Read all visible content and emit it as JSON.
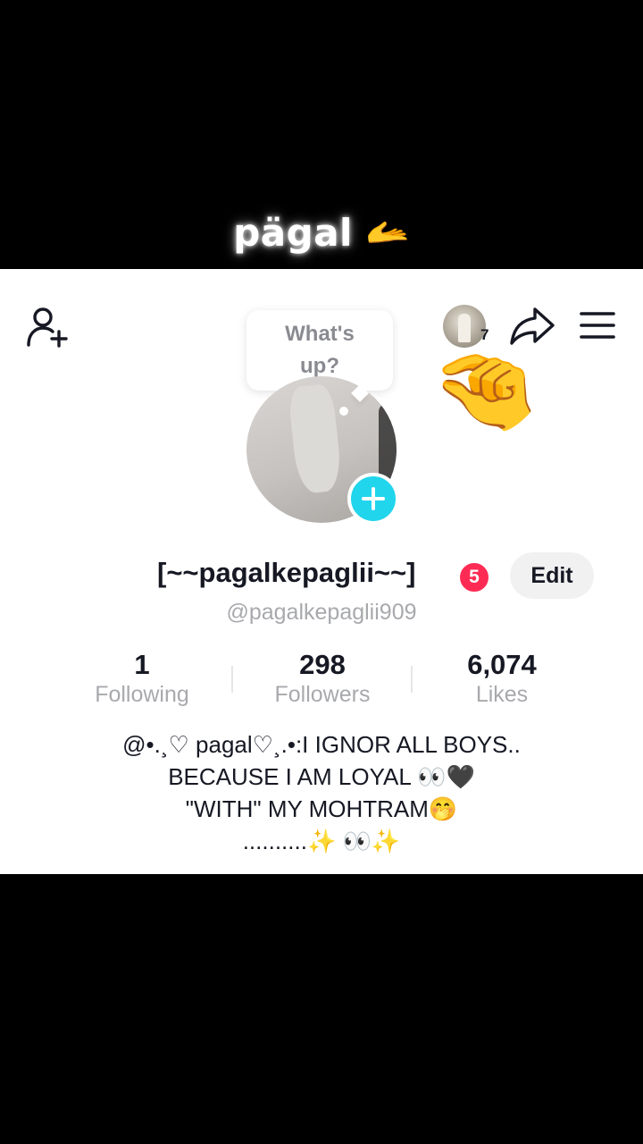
{
  "overlay": {
    "caption_text": "pägal",
    "caption_emoji": "🫴"
  },
  "header": {
    "visitor_count": "7",
    "pinch_emoji": "🤏"
  },
  "status_bubble": {
    "text_line1": "What's",
    "text_line2": "up?"
  },
  "profile": {
    "display_name": "[~~pagalkepaglii~~]",
    "notification_count": "5",
    "edit_label": "Edit",
    "username": "@pagalkepaglii909"
  },
  "stats": [
    {
      "value": "1",
      "label": "Following"
    },
    {
      "value": "298",
      "label": "Followers"
    },
    {
      "value": "6,074",
      "label": "Likes"
    }
  ],
  "bio": [
    "@•.¸♡ pagal♡¸.•:I IGNOR ALL BOYS..",
    "BECAUSE I AM LOYAL 👀🖤",
    "\"WITH\" MY MOHTRAM🤭",
    "..........✨ 👀✨"
  ],
  "colors": {
    "accent": "#fe2c55",
    "add_story": "#20d5ec",
    "text_primary": "#161823",
    "text_secondary": "#a8a9ad"
  }
}
